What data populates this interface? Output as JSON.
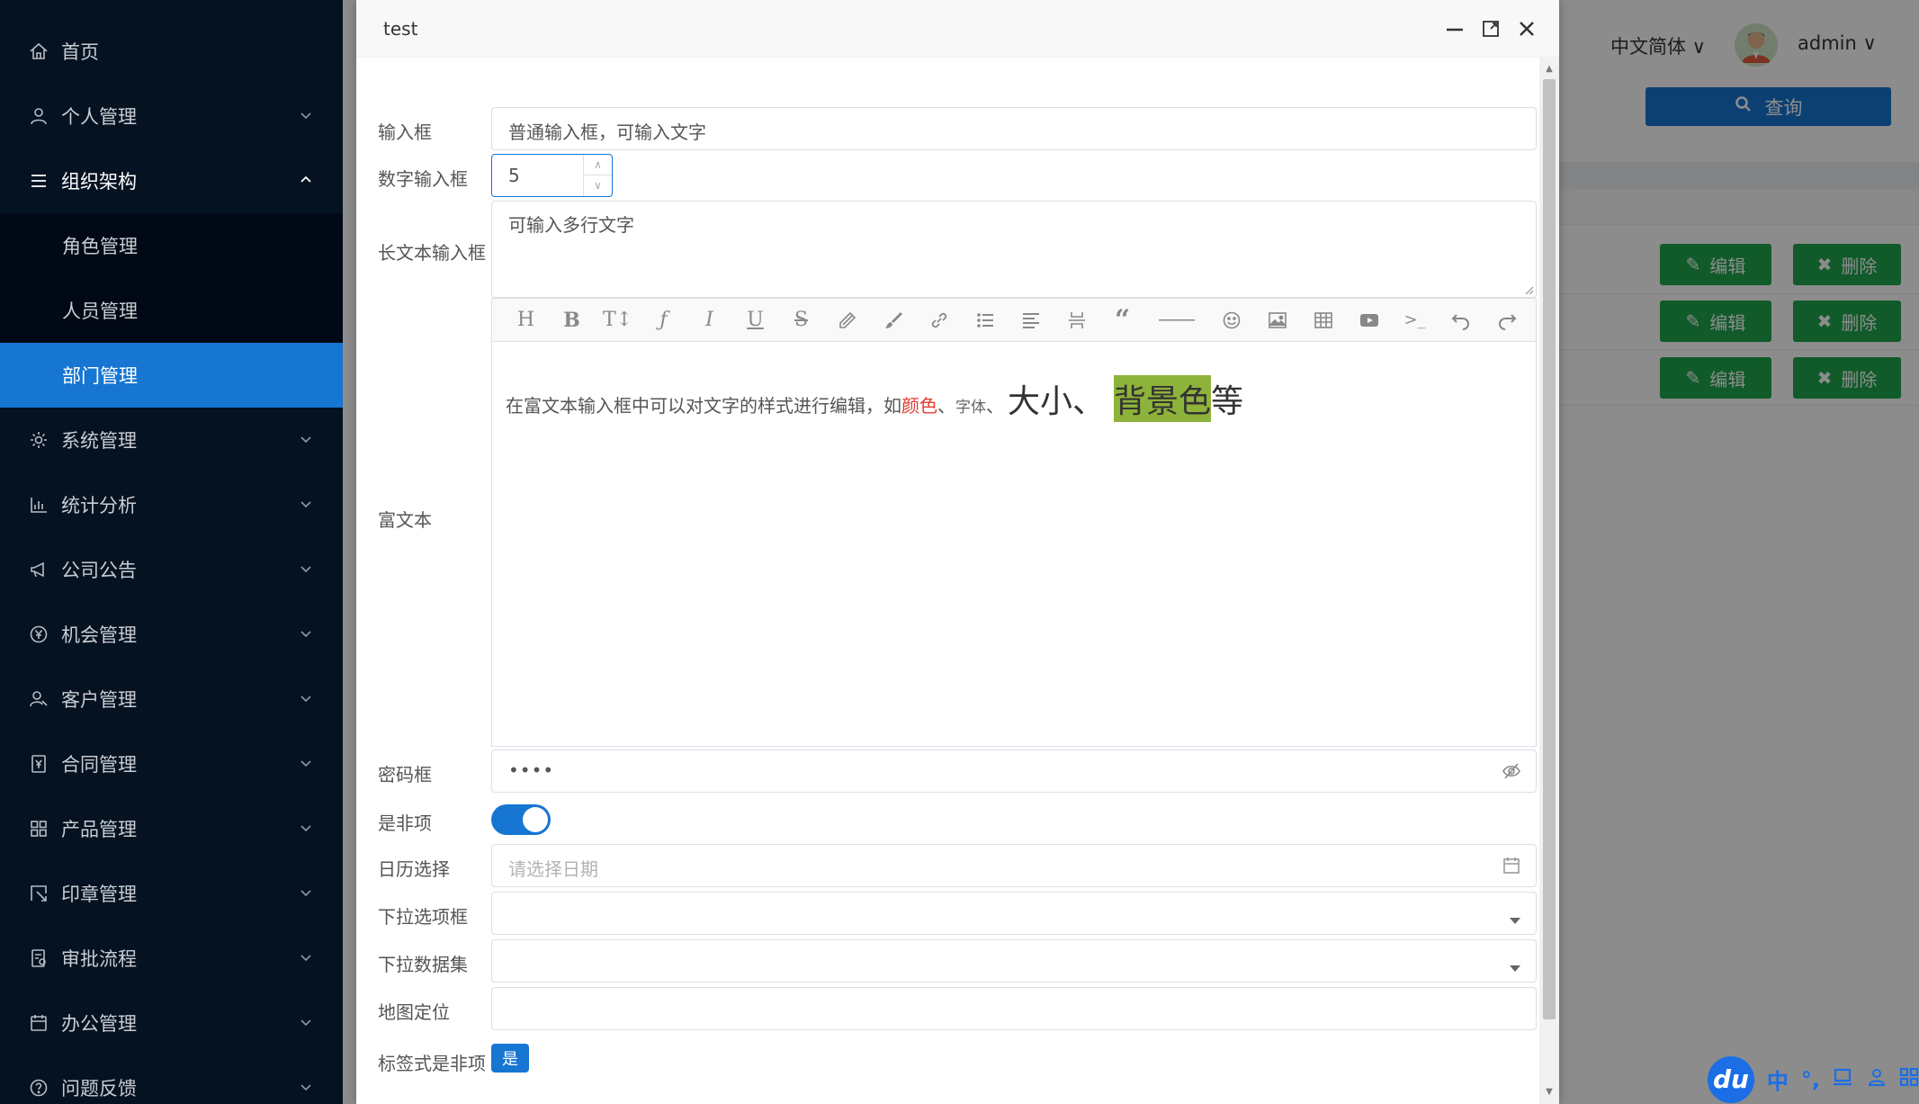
{
  "sidebar": {
    "items": [
      {
        "label": "首页",
        "icon": "home-icon"
      },
      {
        "label": "个人管理",
        "icon": "user-icon"
      },
      {
        "label": "组织架构",
        "icon": "menu-icon"
      },
      {
        "label": "系统管理",
        "icon": "gear-icon"
      },
      {
        "label": "统计分析",
        "icon": "bar-chart-icon"
      },
      {
        "label": "公司公告",
        "icon": "megaphone-icon"
      },
      {
        "label": "机会管理",
        "icon": "yen-icon"
      },
      {
        "label": "客户管理",
        "icon": "customers-icon"
      },
      {
        "label": "合同管理",
        "icon": "contract-icon"
      },
      {
        "label": "产品管理",
        "icon": "grid-icon"
      },
      {
        "label": "印章管理",
        "icon": "stamp-icon"
      },
      {
        "label": "审批流程",
        "icon": "approval-icon"
      },
      {
        "label": "办公管理",
        "icon": "calendar-icon"
      },
      {
        "label": "问题反馈",
        "icon": "question-icon"
      }
    ],
    "submenu": [
      {
        "label": "角色管理"
      },
      {
        "label": "人员管理"
      },
      {
        "label": "部门管理"
      }
    ]
  },
  "header": {
    "language": "中文简体",
    "user": "admin",
    "search_label": "查询"
  },
  "table": {
    "edit_label": "编辑",
    "delete_label": "删除"
  },
  "dialog": {
    "title": "test",
    "fields": {
      "input_label": "输入框",
      "input_value": "普通输入框，可输入文字",
      "number_label": "数字输入框",
      "number_value": "5",
      "textarea_label": "长文本输入框",
      "textarea_value": "可输入多行文字",
      "richtext_label": "富文本",
      "richtext_intro": "在富文本输入框中可以对文字的样式进行编辑，如",
      "richtext_color": "颜色",
      "richtext_sep1": "、",
      "richtext_font": "字体",
      "richtext_sep2": "、",
      "richtext_size": "大小、",
      "richtext_bg": "背景色",
      "richtext_end": "等",
      "password_label": "密码框",
      "password_value": "••••",
      "switch_label": "是非项",
      "switch_on": true,
      "date_label": "日历选择",
      "date_placeholder": "请选择日期",
      "select_label": "下拉选项框",
      "dataset_label": "下拉数据集",
      "map_label": "地图定位",
      "tag_label": "标签式是非项",
      "tag_value": "是"
    },
    "toolbar": [
      "header-icon",
      "bold-icon",
      "font-size-icon",
      "font-family-icon",
      "italic-icon",
      "underline-icon",
      "strikethrough-icon",
      "highlight-icon",
      "brush-icon",
      "link-icon",
      "list-icon",
      "align-icon",
      "page-break-icon",
      "quote-icon",
      "hr-icon",
      "emoji-icon",
      "image-icon",
      "table-icon",
      "video-icon",
      "code-icon",
      "undo-icon",
      "redo-icon"
    ]
  },
  "ime": {
    "logo": "du",
    "mode": "中"
  },
  "colors": {
    "sidebar_bg": "#051222",
    "accent": "#1676d2",
    "success": "#1ea64b",
    "richtext_red": "#e03a2f",
    "highlight_bg": "#8db33a"
  }
}
